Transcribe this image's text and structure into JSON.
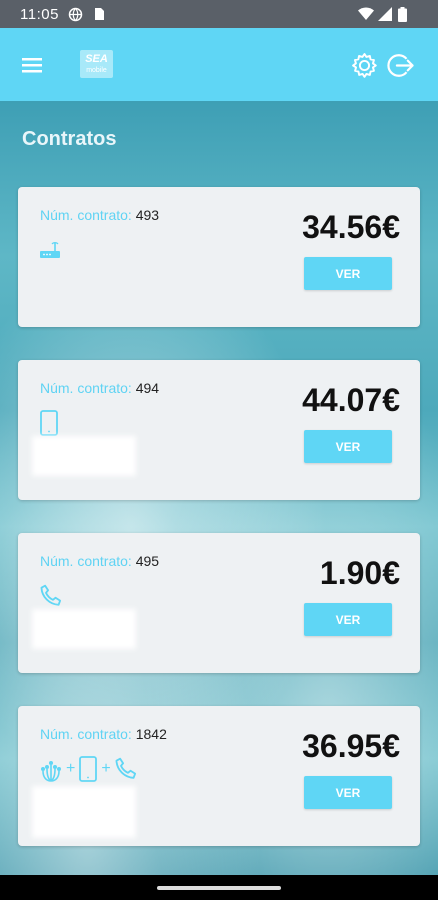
{
  "status_bar": {
    "time": "11:05"
  },
  "app_bar": {
    "logo_top": "SEA",
    "logo_bottom": "mobile"
  },
  "page": {
    "title": "Contratos"
  },
  "contracts": [
    {
      "label": "Núm. contrato:",
      "number": "493",
      "price": "34.56€",
      "button": "VER",
      "icons": [
        "router-icon"
      ]
    },
    {
      "label": "Núm. contrato:",
      "number": "494",
      "price": "44.07€",
      "button": "VER",
      "icons": [
        "mobile-phone-icon"
      ]
    },
    {
      "label": "Núm. contrato:",
      "number": "495",
      "price": "1.90€",
      "button": "VER",
      "icons": [
        "landline-phone-icon"
      ]
    },
    {
      "label": "Núm. contrato:",
      "number": "1842",
      "price": "36.95€",
      "button": "VER",
      "icons": [
        "fiber-icon",
        "mobile-phone-icon",
        "landline-phone-icon"
      ],
      "plus": "+"
    }
  ],
  "colors": {
    "accent": "#5fd6f5",
    "label": "#5fd3f3",
    "card": "#eef1f3"
  }
}
